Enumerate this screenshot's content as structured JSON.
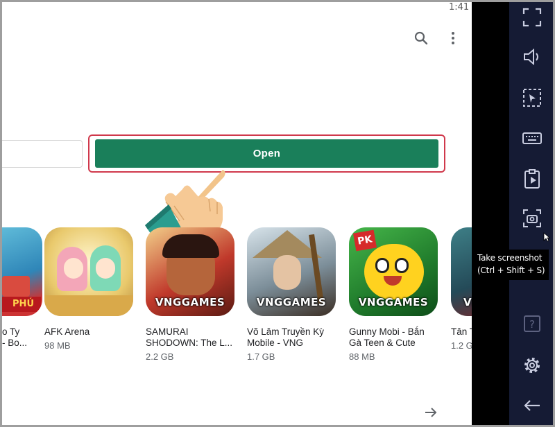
{
  "status_bar": {
    "time": "1:41"
  },
  "toolbar": {
    "search_icon": "search-icon",
    "more_icon": "more-vert-icon"
  },
  "actions": {
    "open_label": "Open"
  },
  "apps": [
    {
      "name": "o Ty\n- Bo...",
      "size": ""
    },
    {
      "name": "AFK Arena",
      "size": "98 MB"
    },
    {
      "name": "SAMURAI\nSHODOWN: The L...",
      "size": "2.2 GB",
      "badge": "VNGGAMES"
    },
    {
      "name": "Võ Lâm Truyền Kỳ\nMobile - VNG",
      "size": "1.7 GB",
      "badge": "VNGGAMES"
    },
    {
      "name": "Gunny Mobi - Bắn\nGà Teen & Cute",
      "size": "88 MB",
      "badge": "VNGGAMES",
      "ribbon": "PK"
    },
    {
      "name": "Tân T",
      "size": "1.2 G",
      "badge": "VNG"
    }
  ],
  "partial_icon_text": "PHÚ",
  "sidebar": {
    "icons": [
      "fullscreen-icon",
      "volume-icon",
      "select-region-icon",
      "keyboard-icon",
      "install-apk-icon",
      "screenshot-icon",
      "help-icon",
      "settings-icon",
      "back-arrow-icon"
    ],
    "help_label": "?"
  },
  "tooltip": {
    "line1": "Take screenshot",
    "line2": "(Ctrl + Shift + S)"
  },
  "colors": {
    "open_button": "#1a7f5a",
    "highlight": "#d0384b",
    "sidebar": "#151b34"
  }
}
